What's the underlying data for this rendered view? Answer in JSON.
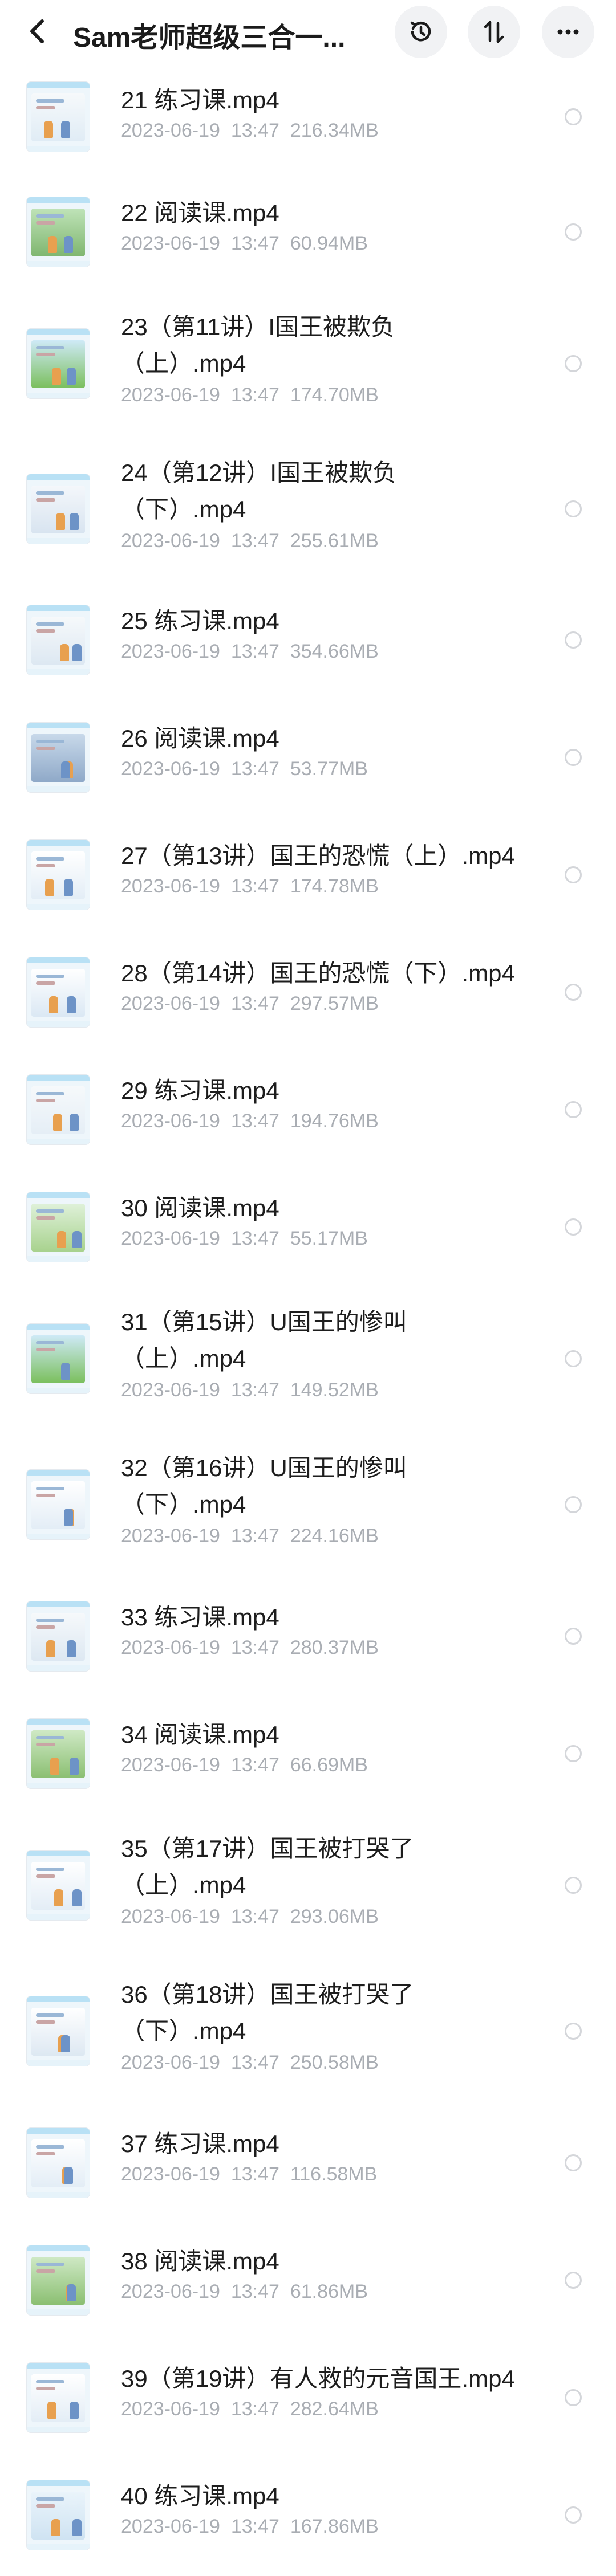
{
  "header": {
    "title": "Sam老师超级三合一...",
    "back_icon": "chevron-left-icon",
    "history_icon": "history-clock-icon",
    "sort_icon": "sort-arrows-icon",
    "more_icon": "more-dots-icon"
  },
  "files": [
    {
      "name": "21 练习课.mp4",
      "date": "2023-06-19",
      "time": "13:47",
      "size": "216.34MB"
    },
    {
      "name": "22 阅读课.mp4",
      "date": "2023-06-19",
      "time": "13:47",
      "size": "60.94MB"
    },
    {
      "name": "23（第11讲）I国王被欺负（上）.mp4",
      "date": "2023-06-19",
      "time": "13:47",
      "size": "174.70MB"
    },
    {
      "name": "24（第12讲）I国王被欺负（下）.mp4",
      "date": "2023-06-19",
      "time": "13:47",
      "size": "255.61MB"
    },
    {
      "name": "25 练习课.mp4",
      "date": "2023-06-19",
      "time": "13:47",
      "size": "354.66MB"
    },
    {
      "name": "26 阅读课.mp4",
      "date": "2023-06-19",
      "time": "13:47",
      "size": "53.77MB"
    },
    {
      "name": "27（第13讲）国王的恐慌（上）.mp4",
      "date": "2023-06-19",
      "time": "13:47",
      "size": "174.78MB"
    },
    {
      "name": "28（第14讲）国王的恐慌（下）.mp4",
      "date": "2023-06-19",
      "time": "13:47",
      "size": "297.57MB"
    },
    {
      "name": "29 练习课.mp4",
      "date": "2023-06-19",
      "time": "13:47",
      "size": "194.76MB"
    },
    {
      "name": "30 阅读课.mp4",
      "date": "2023-06-19",
      "time": "13:47",
      "size": "55.17MB"
    },
    {
      "name": "31（第15讲）U国王的惨叫（上）.mp4",
      "date": "2023-06-19",
      "time": "13:47",
      "size": "149.52MB"
    },
    {
      "name": "32（第16讲）U国王的惨叫（下）.mp4",
      "date": "2023-06-19",
      "time": "13:47",
      "size": "224.16MB"
    },
    {
      "name": "33 练习课.mp4",
      "date": "2023-06-19",
      "time": "13:47",
      "size": "280.37MB"
    },
    {
      "name": "34 阅读课.mp4",
      "date": "2023-06-19",
      "time": "13:47",
      "size": "66.69MB"
    },
    {
      "name": "35（第17讲）国王被打哭了（上）.mp4",
      "date": "2023-06-19",
      "time": "13:47",
      "size": "293.06MB"
    },
    {
      "name": "36（第18讲）国王被打哭了（下）.mp4",
      "date": "2023-06-19",
      "time": "13:47",
      "size": "250.58MB"
    },
    {
      "name": "37 练习课.mp4",
      "date": "2023-06-19",
      "time": "13:47",
      "size": "116.58MB"
    },
    {
      "name": "38 阅读课.mp4",
      "date": "2023-06-19",
      "time": "13:47",
      "size": "61.86MB"
    },
    {
      "name": "39（第19讲）有人救的元音国王.mp4",
      "date": "2023-06-19",
      "time": "13:47",
      "size": "282.64MB"
    },
    {
      "name": "40 练习课.mp4",
      "date": "2023-06-19",
      "time": "13:47",
      "size": "167.86MB"
    }
  ],
  "colors": {
    "title": "#1b1b1b",
    "meta": "#a9adb3",
    "icon_bg": "#f1f2f4",
    "radio_border": "#d4d6da"
  }
}
